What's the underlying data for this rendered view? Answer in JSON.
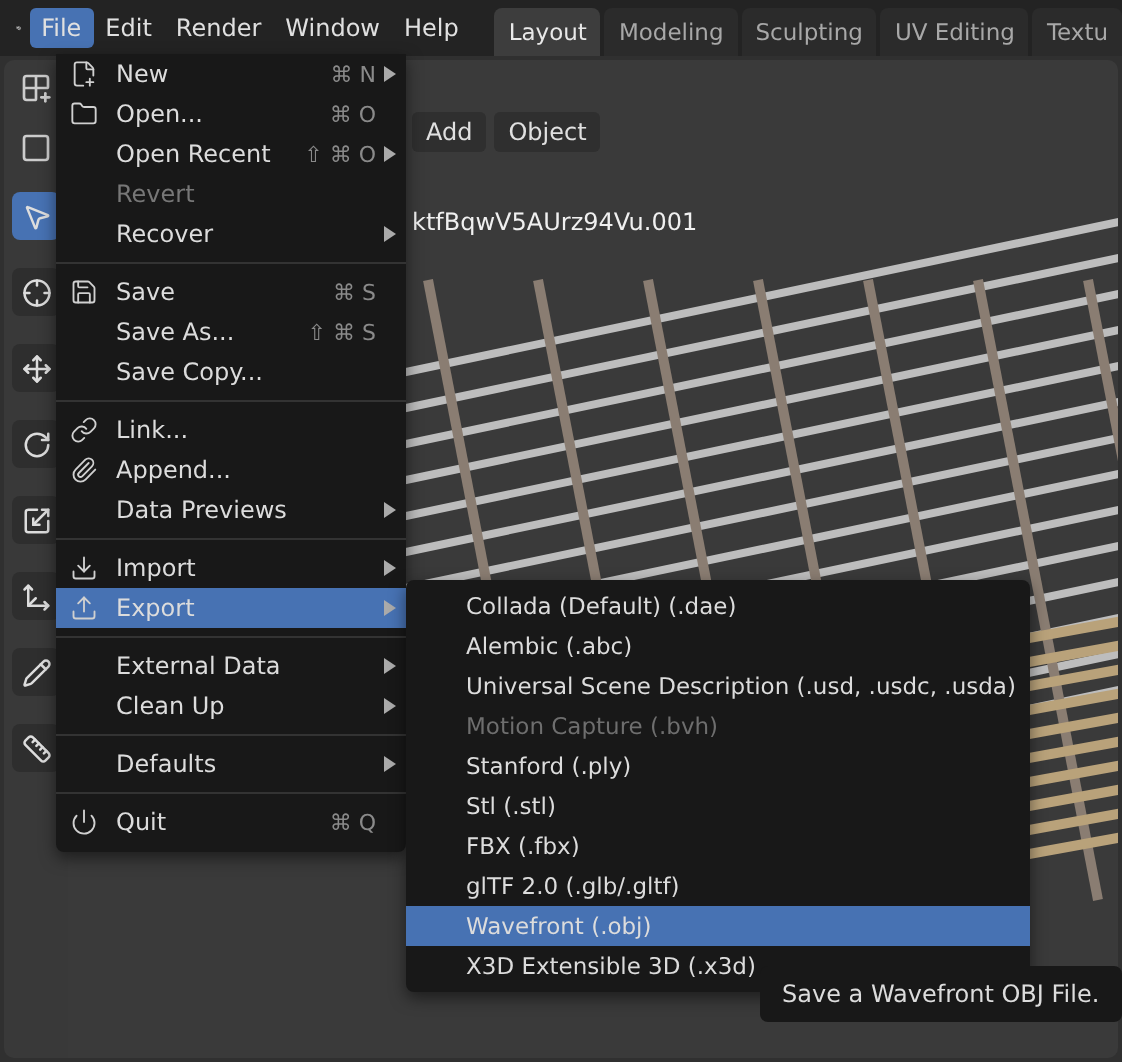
{
  "top_bar": {
    "menus": [
      {
        "label": "File",
        "selected": true
      },
      {
        "label": "Edit",
        "selected": false
      },
      {
        "label": "Render",
        "selected": false
      },
      {
        "label": "Window",
        "selected": false
      },
      {
        "label": "Help",
        "selected": false
      }
    ],
    "workspaces": [
      {
        "label": "Layout",
        "selected": true
      },
      {
        "label": "Modeling",
        "selected": false
      },
      {
        "label": "Sculpting",
        "selected": false
      },
      {
        "label": "UV Editing",
        "selected": false
      },
      {
        "label": "Textu",
        "selected": false
      }
    ]
  },
  "viewport": {
    "header_buttons": [
      "Add",
      "Object"
    ],
    "object_name": "ktfBqwV5AUrz94Vu.001"
  },
  "file_menu": {
    "groups": [
      [
        {
          "label": "New",
          "shortcut": "⌘ N",
          "kind": "new",
          "submenu": true,
          "disabled": false,
          "selected": false
        },
        {
          "label": "Open...",
          "shortcut": "⌘ O",
          "kind": "open",
          "submenu": false,
          "disabled": false,
          "selected": false
        },
        {
          "label": "Open Recent",
          "shortcut": "⇧ ⌘ O",
          "kind": "plain",
          "submenu": true,
          "disabled": false,
          "selected": false
        },
        {
          "label": "Revert",
          "kind": "plain",
          "submenu": false,
          "disabled": true,
          "selected": false
        },
        {
          "label": "Recover",
          "kind": "plain",
          "submenu": true,
          "disabled": false,
          "selected": false
        }
      ],
      [
        {
          "label": "Save",
          "shortcut": "⌘ S",
          "kind": "save",
          "submenu": false,
          "disabled": false,
          "selected": false
        },
        {
          "label": "Save As...",
          "shortcut": "⇧ ⌘ S",
          "kind": "plain",
          "submenu": false,
          "disabled": false,
          "selected": false
        },
        {
          "label": "Save Copy...",
          "kind": "plain",
          "submenu": false,
          "disabled": false,
          "selected": false
        }
      ],
      [
        {
          "label": "Link...",
          "kind": "link",
          "submenu": false,
          "disabled": false,
          "selected": false
        },
        {
          "label": "Append...",
          "kind": "append",
          "submenu": false,
          "disabled": false,
          "selected": false
        },
        {
          "label": "Data Previews",
          "kind": "plain",
          "submenu": true,
          "disabled": false,
          "selected": false
        }
      ],
      [
        {
          "label": "Import",
          "kind": "import",
          "submenu": true,
          "disabled": false,
          "selected": false
        },
        {
          "label": "Export",
          "kind": "export",
          "submenu": true,
          "disabled": false,
          "selected": true
        }
      ],
      [
        {
          "label": "External Data",
          "kind": "plain",
          "submenu": true,
          "disabled": false,
          "selected": false
        },
        {
          "label": "Clean Up",
          "kind": "plain",
          "submenu": true,
          "disabled": false,
          "selected": false
        }
      ],
      [
        {
          "label": "Defaults",
          "kind": "plain",
          "submenu": true,
          "disabled": false,
          "selected": false
        }
      ],
      [
        {
          "label": "Quit",
          "shortcut": "⌘ Q",
          "kind": "quit",
          "submenu": false,
          "disabled": false,
          "selected": false
        }
      ]
    ]
  },
  "export_menu": {
    "items": [
      {
        "label": "Collada (Default) (.dae)",
        "disabled": false,
        "selected": false
      },
      {
        "label": "Alembic (.abc)",
        "disabled": false,
        "selected": false
      },
      {
        "label": "Universal Scene Description (.usd, .usdc, .usda)",
        "disabled": false,
        "selected": false
      },
      {
        "label": "Motion Capture (.bvh)",
        "disabled": true,
        "selected": false
      },
      {
        "label": "Stanford (.ply)",
        "disabled": false,
        "selected": false
      },
      {
        "label": "Stl (.stl)",
        "disabled": false,
        "selected": false
      },
      {
        "label": "FBX (.fbx)",
        "disabled": false,
        "selected": false
      },
      {
        "label": "glTF 2.0 (.glb/.gltf)",
        "disabled": false,
        "selected": false
      },
      {
        "label": "Wavefront (.obj)",
        "disabled": false,
        "selected": true
      },
      {
        "label": "X3D Extensible 3D (.x3d)",
        "disabled": false,
        "selected": false
      }
    ]
  },
  "tooltip": "Save a Wavefront OBJ File."
}
